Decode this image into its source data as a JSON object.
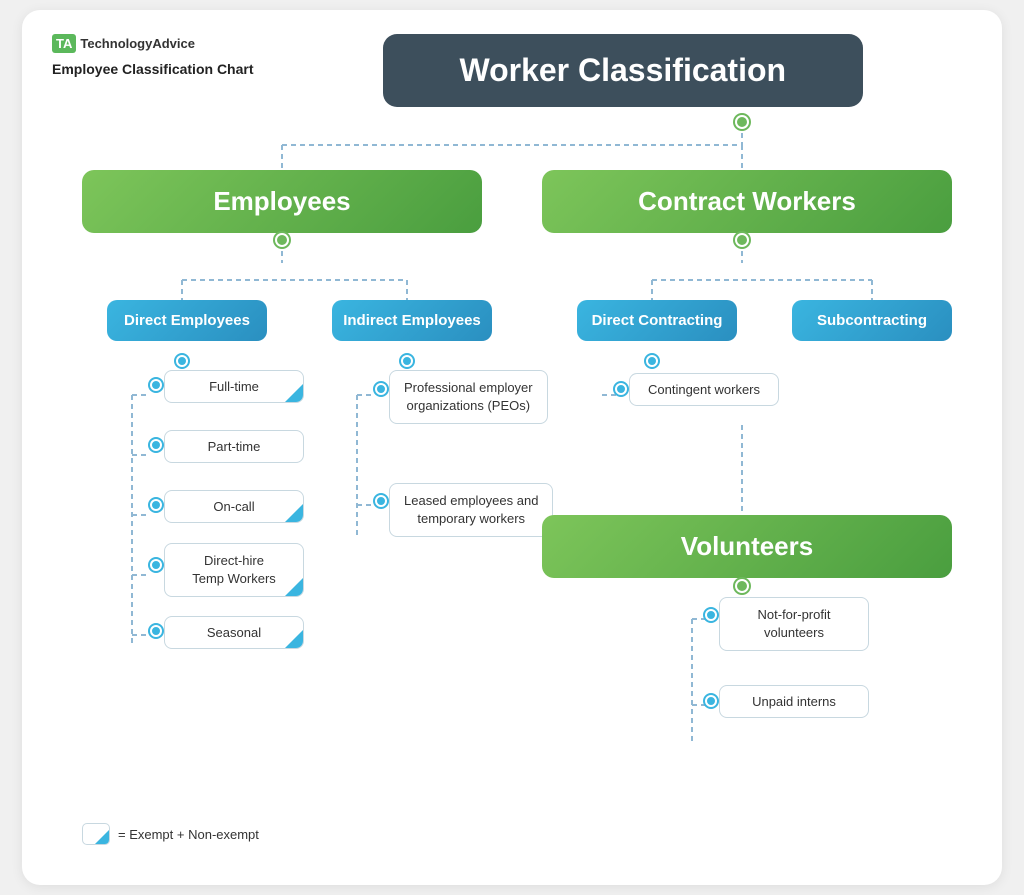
{
  "logo": {
    "ta_label": "TA",
    "brand_name": "TechnologyAdvice"
  },
  "chart_subtitle": "Employee Classification Chart",
  "main_title": "Worker Classification",
  "nodes": {
    "employees": "Employees",
    "contract_workers": "Contract Workers",
    "direct_employees": "Direct Employees",
    "indirect_employees": "Indirect Employees",
    "direct_contracting": "Direct Contracting",
    "subcontracting": "Subcontracting",
    "volunteers": "Volunteers"
  },
  "direct_employees_items": [
    {
      "label": "Full-time",
      "exempt": true
    },
    {
      "label": "Part-time",
      "exempt": false
    },
    {
      "label": "On-call",
      "exempt": true
    },
    {
      "label": "Direct-hire\nTemp Workers",
      "exempt": true
    },
    {
      "label": "Seasonal",
      "exempt": true
    }
  ],
  "indirect_employees_items": [
    {
      "label": "Professional employer\norganizations (PEOs)",
      "exempt": false
    },
    {
      "label": "Leased employees and\ntemporary workers",
      "exempt": false
    }
  ],
  "direct_contracting_items": [
    {
      "label": "Contingent workers",
      "exempt": false
    }
  ],
  "volunteers_items": [
    {
      "label": "Not-for-profit\nvolunteers",
      "exempt": false
    },
    {
      "label": "Unpaid interns",
      "exempt": false
    }
  ],
  "legend_text": "= Exempt + Non-exempt",
  "colors": {
    "main_title_bg": "#3d4f5c",
    "green_node": "#5aaa3f",
    "blue_node": "#2eaad4",
    "connector": "#90b8d4",
    "white_node_border": "#c8d8e0",
    "exempt_triangle": "#2eaad4",
    "green_dot": "#6db85c"
  }
}
